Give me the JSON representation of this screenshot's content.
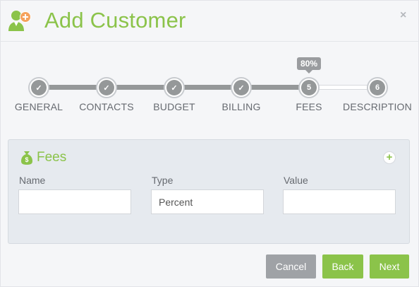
{
  "dialog": {
    "title": "Add Customer",
    "close_label": "×"
  },
  "stepper": {
    "progress_badge": "80%",
    "progress_fraction": 0.8,
    "steps": [
      {
        "label": "GENERAL",
        "marker": "✓",
        "state": "done"
      },
      {
        "label": "CONTACTS",
        "marker": "✓",
        "state": "done"
      },
      {
        "label": "BUDGET",
        "marker": "✓",
        "state": "done"
      },
      {
        "label": "BILLING",
        "marker": "✓",
        "state": "done"
      },
      {
        "label": "FEES",
        "marker": "5",
        "state": "current"
      },
      {
        "label": "DESCRIPTION",
        "marker": "6",
        "state": "pending"
      }
    ]
  },
  "fees": {
    "title": "Fees",
    "add_label": "+",
    "fields": [
      {
        "label": "Name",
        "value": "",
        "placeholder": ""
      },
      {
        "label": "Type",
        "value": "Percent",
        "placeholder": ""
      },
      {
        "label": "Value",
        "value": "",
        "placeholder": ""
      }
    ]
  },
  "footer": {
    "cancel_label": "Cancel",
    "back_label": "Back",
    "next_label": "Next"
  },
  "colors": {
    "accent": "#8bc34a",
    "step": "#959899",
    "cancel": "#9fa2a6"
  }
}
